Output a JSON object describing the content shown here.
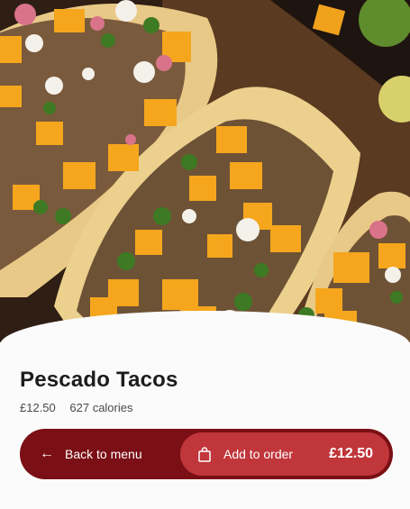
{
  "item": {
    "name": "Pescado Tacos",
    "price": "£12.50",
    "calories": "627 calories",
    "image_icon": "tacos-photo"
  },
  "actions": {
    "back_label": "Back to menu",
    "back_icon": "arrow-left-icon",
    "add_label": "Add to order",
    "add_icon": "shopping-bag-icon",
    "add_price": "£12.50"
  },
  "colors": {
    "action_bar": "#7a0f15",
    "add_button": "#c0363a",
    "title_text": "#1d1d1d"
  }
}
